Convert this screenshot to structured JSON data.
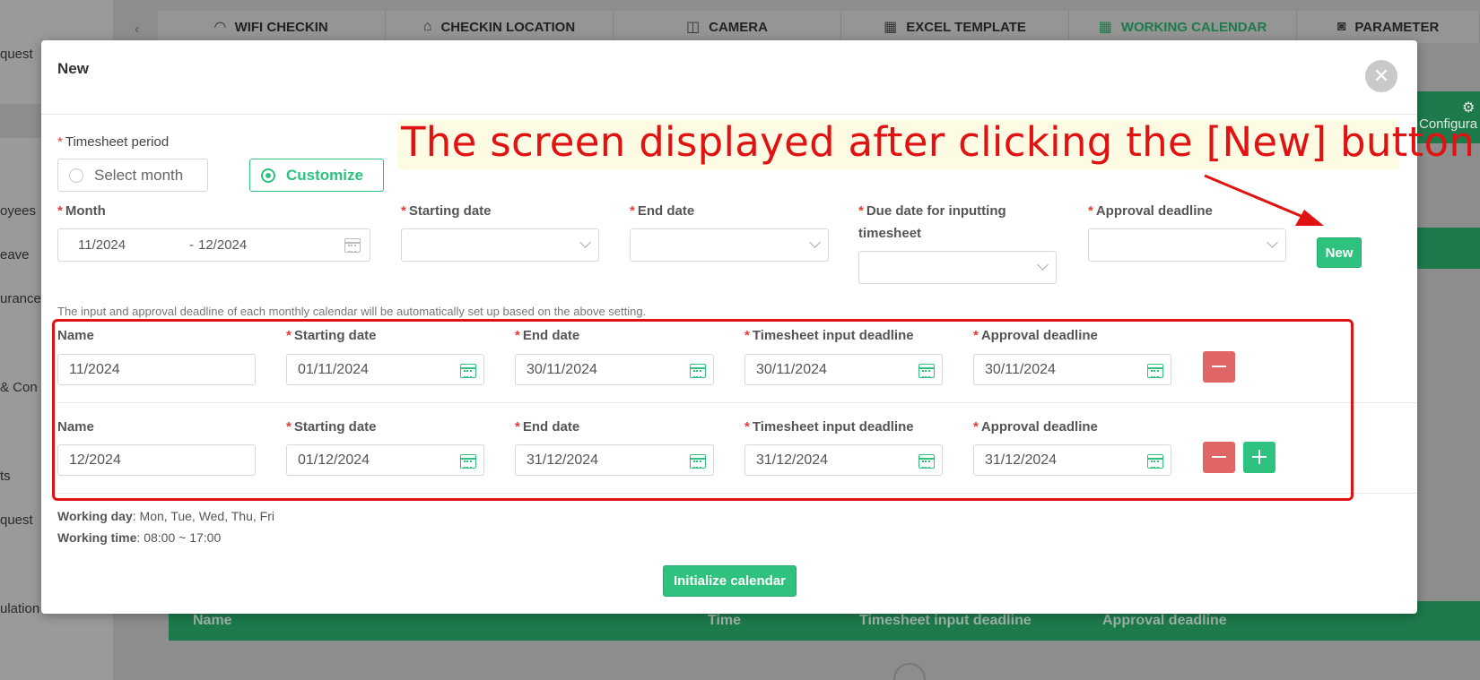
{
  "background": {
    "sidebar_items": [
      "quest",
      "oyees",
      "eave",
      "urance",
      "& Con",
      "ts",
      "quest",
      "ulation"
    ],
    "tabs": [
      {
        "icon": "wifi-icon",
        "label": "WIFI CHECKIN",
        "active": false
      },
      {
        "icon": "location-icon",
        "label": "CHECKIN LOCATION",
        "active": false
      },
      {
        "icon": "camera-icon",
        "label": "CAMERA",
        "active": false
      },
      {
        "icon": "grid-icon",
        "label": "EXCEL TEMPLATE",
        "active": false
      },
      {
        "icon": "calendar-icon",
        "label": "WORKING CALENDAR",
        "active": true
      },
      {
        "icon": "photo-icon",
        "label": "PARAMETER",
        "active": false
      }
    ],
    "config_label": "Configura",
    "table_headers": [
      "Name",
      "Time",
      "Timesheet input deadline",
      "Approval deadline"
    ]
  },
  "modal": {
    "title": "New",
    "timesheet_period_label": "Timesheet period",
    "options": {
      "select_month": "Select month",
      "customize": "Customize"
    },
    "selected_option": "customize",
    "month_label": "Month",
    "month_from": "11/2024",
    "month_sep": "-",
    "month_to": "12/2024",
    "starting_date_label": "Starting date",
    "end_date_label": "End date",
    "due_date_label_line1": "Due date for inputting",
    "due_date_label_line2": "timesheet",
    "approval_deadline_label": "Approval deadline",
    "new_button": "New",
    "hint": "The input and approval deadline of each monthly calendar will be automatically set up based on the above setting.",
    "row_labels": {
      "name": "Name",
      "starting_date": "Starting date",
      "end_date": "End date",
      "input_deadline": "Timesheet input deadline",
      "approval_deadline": "Approval deadline"
    },
    "rows": [
      {
        "name": "11/2024",
        "start": "01/11/2024",
        "end": "30/11/2024",
        "input_deadline": "30/11/2024",
        "approval_deadline": "30/11/2024"
      },
      {
        "name": "12/2024",
        "start": "01/12/2024",
        "end": "31/12/2024",
        "input_deadline": "31/12/2024",
        "approval_deadline": "31/12/2024"
      }
    ],
    "working_day_label": "Working day",
    "working_day_value": ": Mon, Tue, Wed, Thu, Fri",
    "working_time_label": "Working time",
    "working_time_value": ": 08:00 ~ 17:00",
    "initialize_button": "Initialize calendar"
  },
  "annotation": {
    "text": "The screen displayed after clicking the [New] button",
    "color": "#e01212"
  }
}
